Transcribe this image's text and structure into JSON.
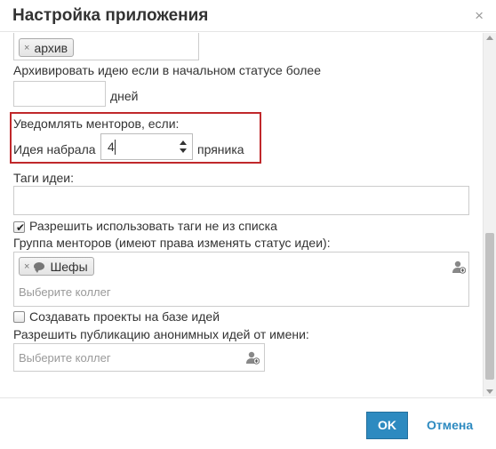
{
  "dialog": {
    "title": "Настройка приложения",
    "close_icon": "×"
  },
  "archive_status": {
    "tag_label": "архив",
    "tag_remove_icon": "×"
  },
  "archive_days": {
    "label": "Архивировать идею если в начальном статусе более",
    "value": "",
    "unit": "дней"
  },
  "notify_mentors": {
    "heading": "Уведомлять менторов, если:",
    "prefix": "Идея набрала",
    "value": "4",
    "suffix": "пряника",
    "highlight_color": "#c0282b"
  },
  "idea_tags": {
    "label": "Таги идеи:",
    "value": ""
  },
  "allow_free_tags": {
    "label": "Разрешить использовать таги не из списка",
    "checked": true
  },
  "mentors_group": {
    "label": "Группа менторов (имеют права изменять статус идеи):",
    "tag_label": "Шефы",
    "tag_icon": "speech-bubble-icon",
    "tag_remove_icon": "×",
    "placeholder": "Выберите коллег",
    "add_icon": "add-user-icon"
  },
  "create_projects": {
    "label": "Создавать проекты на базе идей",
    "checked": false
  },
  "anonymous_publish": {
    "label": "Разрешить публикацию анонимных идей от имени:",
    "placeholder": "Выберите коллег",
    "add_icon": "add-user-icon"
  },
  "footer": {
    "ok_label": "OK",
    "cancel_label": "Отмена"
  },
  "colors": {
    "accent": "#2d8ac0",
    "border": "#cccccc",
    "text": "#333333"
  }
}
